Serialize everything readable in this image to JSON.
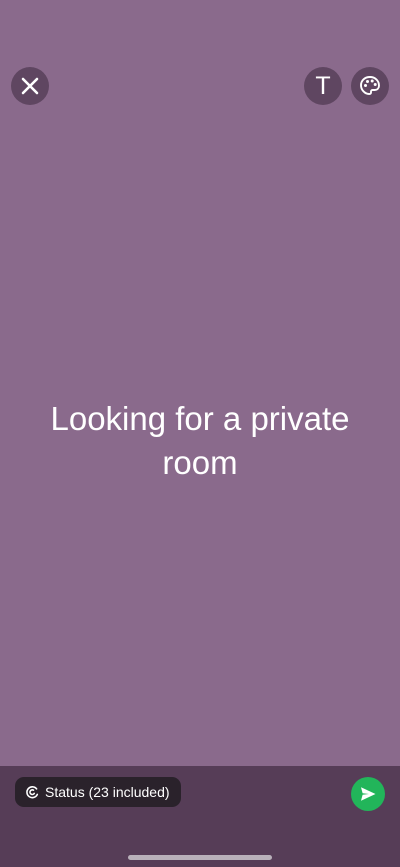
{
  "toolbar": {
    "close_icon": "close-icon",
    "text_label": "T",
    "palette_icon": "palette-icon"
  },
  "status": {
    "text": "Looking for a private room",
    "background_color": "#8A6A8C"
  },
  "footer": {
    "audience_label": "Status (23 included)",
    "audience_icon": "status-icon",
    "send_icon": "send-icon",
    "send_color": "#22B55A"
  }
}
